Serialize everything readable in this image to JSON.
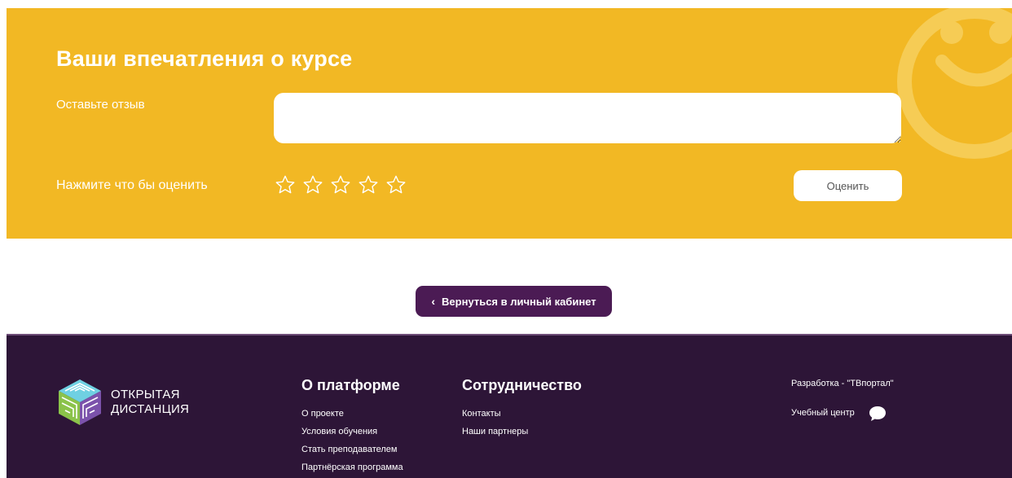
{
  "review": {
    "title": "Ваши впечатления о курсе",
    "comment_label": "Оставьте отзыв",
    "comment_value": "",
    "rate_label": "Нажмите что бы оценить",
    "stars_selected": 0,
    "stars_total": 5,
    "submit_label": "Оценить",
    "background_color": "#f2b824"
  },
  "back_button": {
    "label": "Вернуться в личный кабинет",
    "icon": "chevron-left-icon",
    "color": "#4b1b54"
  },
  "footer": {
    "background_color": "#2d1537",
    "logo": {
      "line1": "ОТКРЫТАЯ",
      "line2": "ДИСТАНЦИЯ"
    },
    "platform": {
      "title": "О платформе",
      "links": [
        "О проекте",
        "Условия обучения",
        "Стать преподавателем",
        "Партнёрская программа"
      ]
    },
    "cooperation": {
      "title": "Сотрудничество",
      "links": [
        "Контакты",
        "Наши партнеры"
      ]
    },
    "developer": "Разработка - \"ТВпортал\"",
    "training_center": "Учебный центр",
    "chat_icon": "chat-bubble-icon"
  }
}
